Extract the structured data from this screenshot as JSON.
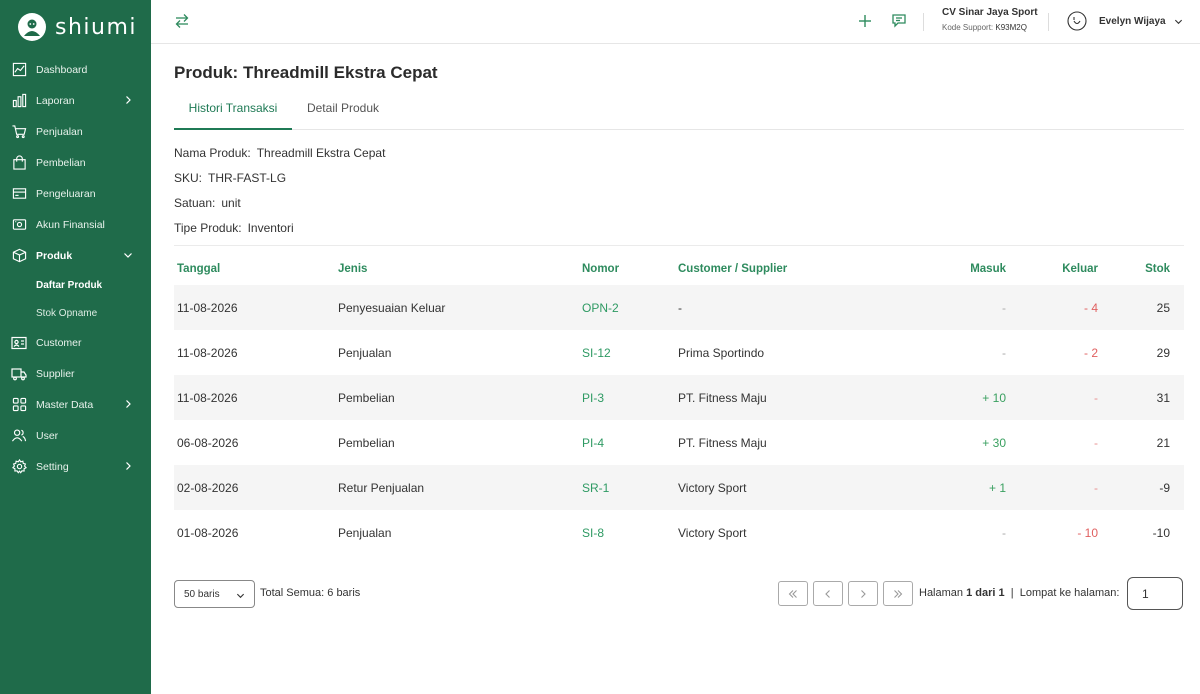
{
  "app": {
    "brand": "shiumi"
  },
  "sidebar": {
    "items": [
      {
        "label": "Dashboard",
        "icon": "chart-line-icon"
      },
      {
        "label": "Laporan",
        "icon": "bar-chart-icon",
        "has_children": true
      },
      {
        "label": "Penjualan",
        "icon": "cart-icon"
      },
      {
        "label": "Pembelian",
        "icon": "shopping-bag-icon"
      },
      {
        "label": "Pengeluaran",
        "icon": "credit-card-icon"
      },
      {
        "label": "Akun Finansial",
        "icon": "wallet-icon"
      },
      {
        "label": "Produk",
        "icon": "box-icon",
        "expanded": true
      },
      {
        "label": "Customer",
        "icon": "id-card-icon"
      },
      {
        "label": "Supplier",
        "icon": "truck-icon"
      },
      {
        "label": "Master Data",
        "icon": "grid-icon",
        "has_children": true
      },
      {
        "label": "User",
        "icon": "users-icon"
      },
      {
        "label": "Setting",
        "icon": "gear-icon",
        "has_children": true
      }
    ],
    "sub_items": [
      {
        "label": "Daftar Produk",
        "active": true
      },
      {
        "label": "Stok Opname",
        "active": false
      }
    ]
  },
  "header": {
    "company_name": "CV Sinar Jaya Sport",
    "support_label": "Kode Support:",
    "support_code": "K93M2Q",
    "user_name": "Evelyn Wijaya"
  },
  "page": {
    "title": "Produk: Threadmill Ekstra Cepat",
    "tabs": [
      "Histori Transaksi",
      "Detail Produk"
    ],
    "active_tab": 0
  },
  "product_info": {
    "name_label": "Nama Produk:",
    "name": "Threadmill Ekstra Cepat",
    "sku_label": "SKU:",
    "sku": "THR-FAST-LG",
    "unit_label": "Satuan:",
    "unit": "unit",
    "type_label": "Tipe Produk:",
    "type": "Inventori"
  },
  "table": {
    "headers": {
      "date": "Tanggal",
      "type": "Jenis",
      "number": "Nomor",
      "party": "Customer / Supplier",
      "in": "Masuk",
      "out": "Keluar",
      "stock": "Stok"
    },
    "rows": [
      {
        "date": "11-08-2026",
        "type": "Penyesuaian Keluar",
        "number": "OPN-2",
        "party": "-",
        "in": "-",
        "out": "- 4",
        "stock": "25"
      },
      {
        "date": "11-08-2026",
        "type": "Penjualan",
        "number": "SI-12",
        "party": "Prima Sportindo",
        "in": "-",
        "out": "- 2",
        "stock": "29"
      },
      {
        "date": "11-08-2026",
        "type": "Pembelian",
        "number": "PI-3",
        "party": "PT. Fitness Maju",
        "in": "+ 10",
        "out": "-",
        "stock": "31"
      },
      {
        "date": "06-08-2026",
        "type": "Pembelian",
        "number": "PI-4",
        "party": "PT. Fitness Maju",
        "in": "+ 30",
        "out": "-",
        "stock": "21"
      },
      {
        "date": "02-08-2026",
        "type": "Retur Penjualan",
        "number": "SR-1",
        "party": "Victory Sport",
        "in": "+ 1",
        "out": "-",
        "stock": "-9"
      },
      {
        "date": "01-08-2026",
        "type": "Penjualan",
        "number": "SI-8",
        "party": "Victory Sport",
        "in": "-",
        "out": "- 10",
        "stock": "-10"
      }
    ]
  },
  "pagination": {
    "rows_per_page": "50 baris",
    "total_label": "Total Semua:",
    "total_value": "6 baris",
    "page_label": "Halaman",
    "current_page": "1",
    "of_label": "dari",
    "total_pages": "1",
    "jump_label": "Lompat ke halaman:",
    "jump_value": "1"
  },
  "colors": {
    "sidebar": "#1f6b4a",
    "accent": "#2e8b5e",
    "positive": "#3aa060",
    "negative": "#e06060"
  }
}
